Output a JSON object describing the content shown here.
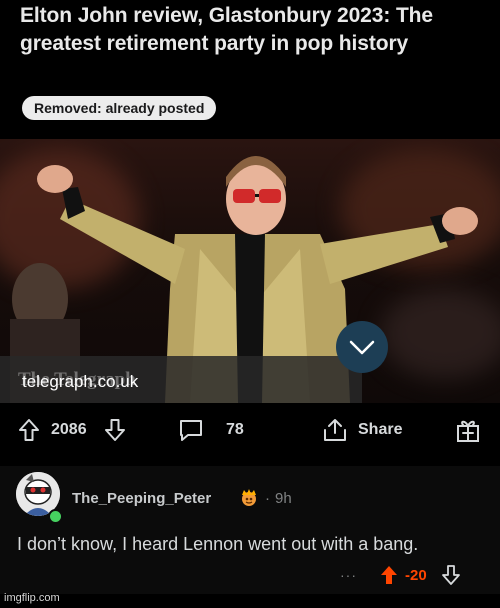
{
  "post": {
    "title": "Elton John review, Glastonbury 2023: The greatest retirement party in pop history",
    "flair": "Removed: already posted",
    "image_source": "The Telegraph",
    "link_domain": "telegraph.co.uk",
    "upvotes": "2086",
    "comments": "78",
    "share_label": "Share"
  },
  "comment": {
    "username": "The_Peeping_Peter",
    "age": "9h",
    "separator": "·",
    "text": "I don’t know, I heard Lennon went out with a bang.",
    "more": "···",
    "score": "-20"
  },
  "watermark": "imgflip.com",
  "colors": {
    "flair_bg": "#ececec",
    "downvoted": "#ff4500",
    "link_bar": "#282828",
    "chevron_bg": "#1d3e55",
    "online": "#46d160"
  },
  "icons": [
    "upvote-icon",
    "downvote-icon",
    "comment-icon",
    "share-icon",
    "award-icon",
    "chevron-down-icon",
    "avatar-icon",
    "award-badge-icon"
  ]
}
